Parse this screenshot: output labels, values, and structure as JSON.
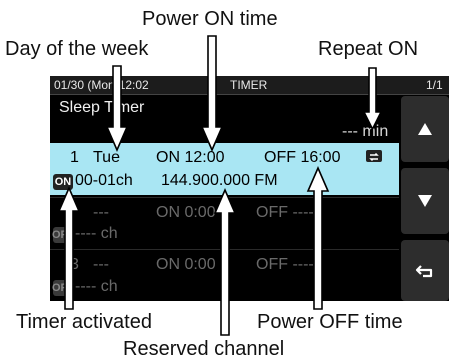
{
  "callouts": {
    "power_on_time": "Power ON time",
    "day_of_week": "Day of the week",
    "repeat_on": "Repeat ON",
    "timer_activated": "Timer activated",
    "power_off_time": "Power OFF time",
    "reserved_channel": "Reserved channel"
  },
  "status_bar": {
    "datetime": "01/30 (Mon)12:02",
    "title": "TIMER",
    "page": "1/1"
  },
  "screen_title": "Sleep Timer",
  "sleep_value": "--- min",
  "rows": [
    {
      "num": "1",
      "day": "Tue",
      "on": "ON 12:00",
      "off": "OFF 16:00",
      "status": "ON",
      "channel": "00-01ch",
      "freq": "144.900.000 FM",
      "repeat_icon": "repeat-icon",
      "selected": true
    },
    {
      "num": "",
      "day": "---",
      "on": "ON 0:00",
      "off": "OFF -----",
      "status": "OFF",
      "channel": "---- ch",
      "freq": "",
      "selected": false
    },
    {
      "num": "3",
      "day": "---",
      "on": "ON 0:00",
      "off": "OFF -----",
      "status": "OFF",
      "channel": "---- ch",
      "freq": "",
      "selected": false
    }
  ],
  "buttons": {
    "up_icon": "triangle-up-icon",
    "down_icon": "triangle-down-icon",
    "back_icon": "return-icon"
  },
  "colors": {
    "selected_row": "#a9e6f3",
    "on_badge": "#222222",
    "off_badge": "#3a3a3a"
  }
}
